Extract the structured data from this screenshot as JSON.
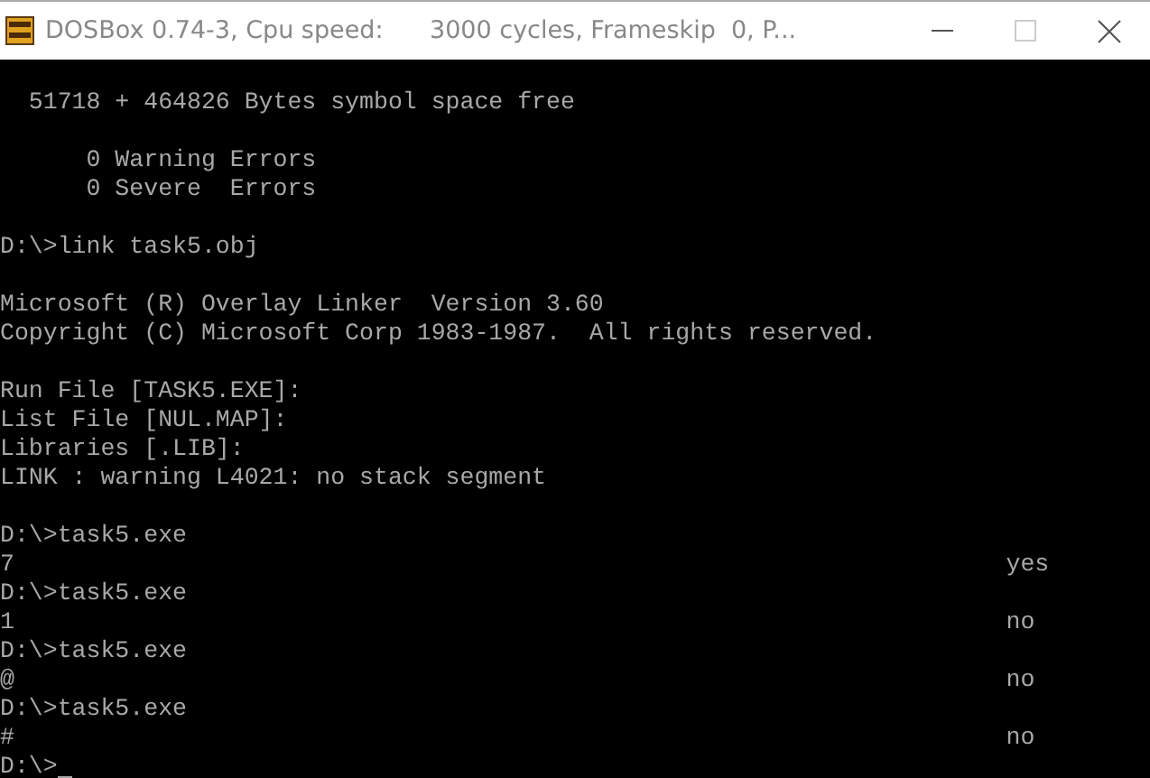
{
  "window": {
    "title": "DOSBox 0.74-3, Cpu speed:      3000 cycles, Frameskip  0, P..."
  },
  "console": {
    "lines": [
      {
        "kind": "blank"
      },
      {
        "kind": "text",
        "text": "  51718 + 464826 Bytes symbol space free"
      },
      {
        "kind": "blank"
      },
      {
        "kind": "text",
        "text": "      0 Warning Errors"
      },
      {
        "kind": "text",
        "text": "      0 Severe  Errors"
      },
      {
        "kind": "blank"
      },
      {
        "kind": "text",
        "text": "D:\\>link task5.obj"
      },
      {
        "kind": "blank"
      },
      {
        "kind": "text",
        "text": "Microsoft (R) Overlay Linker  Version 3.60"
      },
      {
        "kind": "text",
        "text": "Copyright (C) Microsoft Corp 1983-1987.  All rights reserved."
      },
      {
        "kind": "blank"
      },
      {
        "kind": "text",
        "text": "Run File [TASK5.EXE]:"
      },
      {
        "kind": "text",
        "text": "List File [NUL.MAP]:"
      },
      {
        "kind": "text",
        "text": "Libraries [.LIB]:"
      },
      {
        "kind": "text",
        "text": "LINK : warning L4021: no stack segment"
      },
      {
        "kind": "blank"
      },
      {
        "kind": "text",
        "text": "D:\\>task5.exe"
      },
      {
        "kind": "output",
        "text": "7",
        "result": "yes"
      },
      {
        "kind": "text",
        "text": "D:\\>task5.exe"
      },
      {
        "kind": "output",
        "text": "1",
        "result": "no"
      },
      {
        "kind": "text",
        "text": "D:\\>task5.exe"
      },
      {
        "kind": "output",
        "text": "@",
        "result": "no"
      },
      {
        "kind": "text",
        "text": "D:\\>task5.exe"
      },
      {
        "kind": "output",
        "text": "#",
        "result": "no"
      },
      {
        "kind": "prompt",
        "text": "D:\\>"
      }
    ]
  }
}
